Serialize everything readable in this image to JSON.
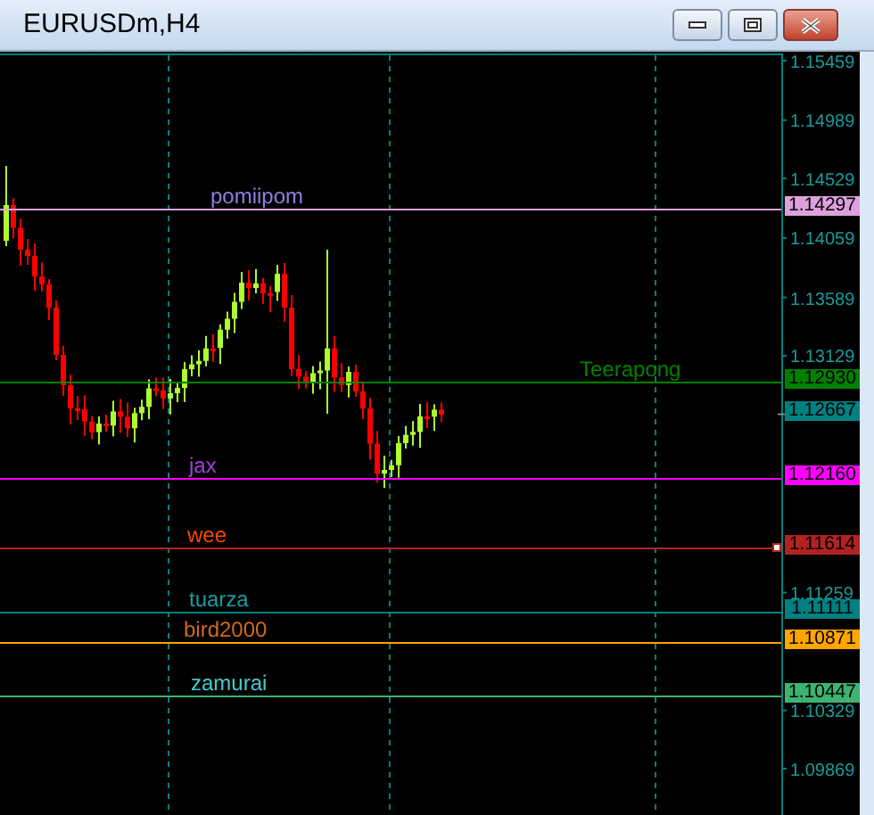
{
  "window": {
    "title": "EURUSDm,H4"
  },
  "price_axis": {
    "ticks": [
      "1.15459",
      "1.14989",
      "1.14529",
      "1.14059",
      "1.13589",
      "1.13129",
      "1.11259",
      "1.10329",
      "1.09869"
    ]
  },
  "horizontal_lines": [
    {
      "price": "1.14297",
      "color": "#dda0dd",
      "selected": false,
      "label": {
        "text": "pomiipom",
        "color": "#8f7fe0"
      }
    },
    {
      "price": "1.12930",
      "color": "#008000",
      "selected": false,
      "label": {
        "text": "Teerapong",
        "color": "#008000"
      }
    },
    {
      "price": "1.12160",
      "color": "#ff00ff",
      "selected": false,
      "label": {
        "text": "jax",
        "color": "#a040d8"
      }
    },
    {
      "price": "1.11614",
      "color": "#b22222",
      "selected": true,
      "label": {
        "text": "wee",
        "color": "#ff4500"
      }
    },
    {
      "price": "1.11111",
      "color": "#008080",
      "selected": false,
      "label": {
        "text": "tuarza",
        "color": "#1a9aa0"
      }
    },
    {
      "price": "1.10871",
      "color": "#ffa500",
      "selected": false,
      "label": {
        "text": "bird2000",
        "color": "#d2691e"
      }
    },
    {
      "price": "1.10447",
      "color": "#3cb371",
      "selected": false,
      "label": {
        "text": "zamurai",
        "color": "#48c8d0"
      }
    }
  ],
  "bid_label": {
    "price": "1.12667"
  }
}
